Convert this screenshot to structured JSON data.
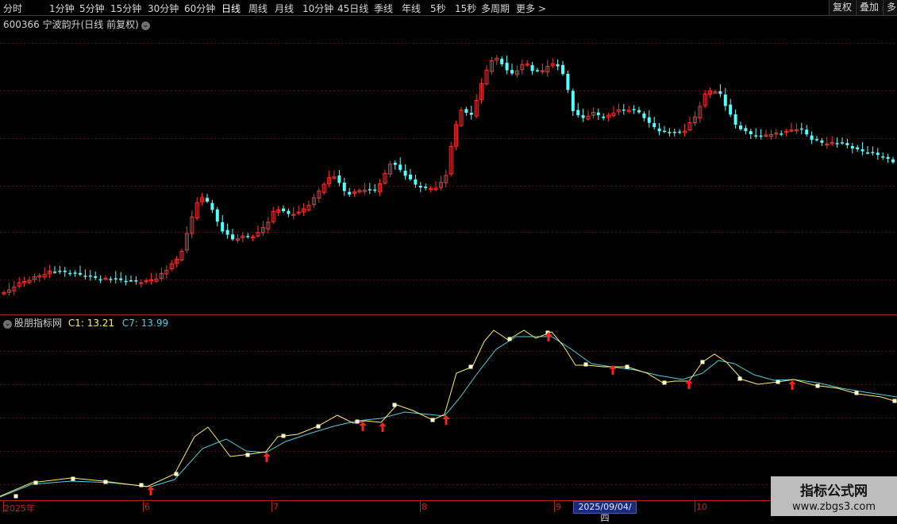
{
  "toolbar": {
    "periods": [
      "分时",
      "1分钟",
      "5分钟",
      "15分钟",
      "30分钟",
      "60分钟",
      "日线",
      "周线",
      "月线",
      "10分钟",
      "45日线",
      "季线",
      "年线",
      "5秒",
      "15秒",
      "多周期",
      "更多 >"
    ],
    "active_index": 6,
    "right_buttons": [
      "复权",
      "叠加",
      "多"
    ]
  },
  "main_chart": {
    "title": "600366 宁波韵升(日线 前复权)",
    "up_color": "#ff3030",
    "down_color": "#54ffff"
  },
  "indicator": {
    "name": "股朋指标网",
    "c1_label": "C1: 13.21",
    "c7_label": "C7: 13.99",
    "c1_color": "#ffee66",
    "c7_color": "#4fd0e0",
    "signal_color": "#ff2020"
  },
  "time_axis": {
    "labels": [
      "2025年",
      "6",
      "7",
      "8",
      "9",
      "10"
    ],
    "crosshair_date": "2025/09/04/四"
  },
  "watermark": {
    "line1": "指标公式网",
    "line2": "www.zbgs3.com"
  }
}
